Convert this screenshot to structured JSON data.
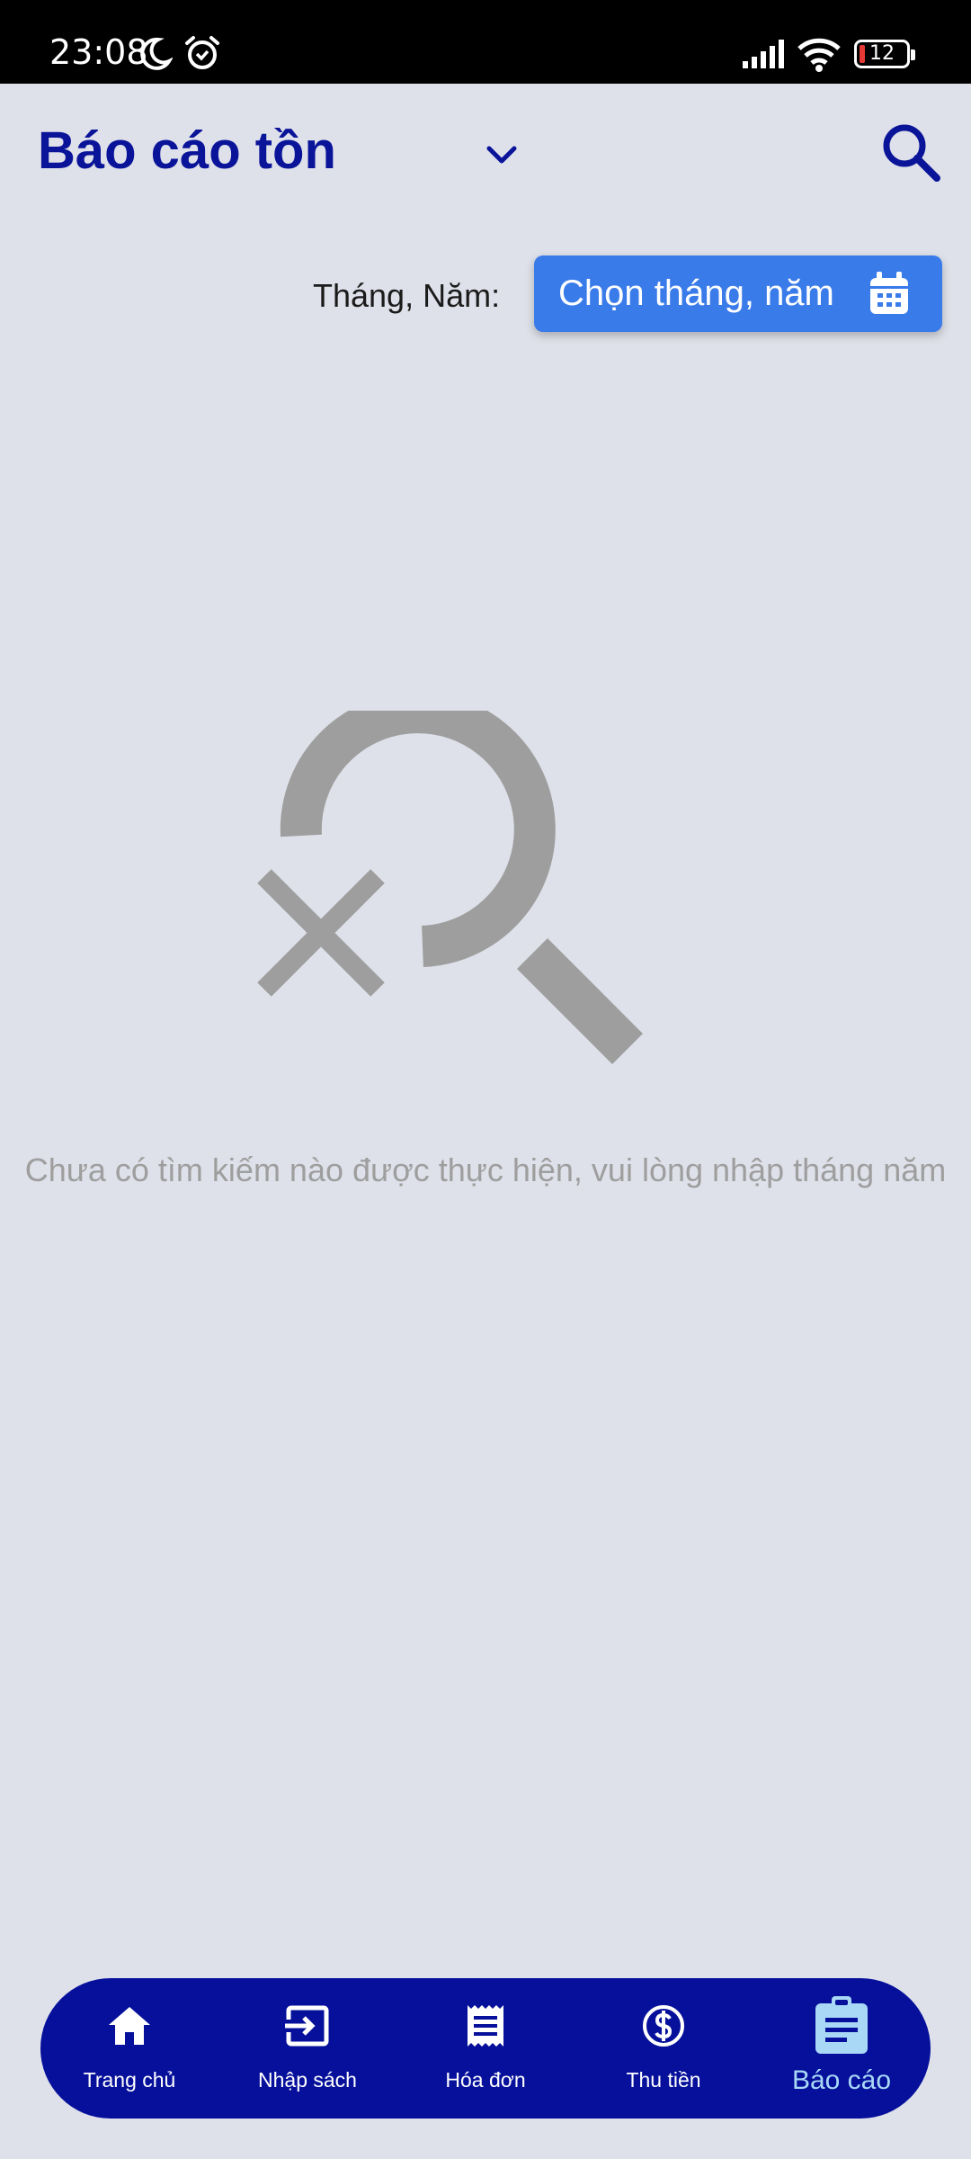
{
  "status_bar": {
    "time": "23:08",
    "icons": [
      "moon-icon",
      "alarm-icon",
      "signal-icon",
      "wifi-icon",
      "battery-icon"
    ],
    "battery_level": "12"
  },
  "header": {
    "title": "Báo cáo tồn",
    "dropdown_icon": "chevron-down-icon",
    "search_icon": "search-icon"
  },
  "filter": {
    "label": "Tháng, Năm:",
    "button_label": "Chọn tháng, năm",
    "button_icon": "calendar-icon"
  },
  "empty_state": {
    "icon": "search-off-icon",
    "message": "Chưa có tìm kiếm nào được thực hiện, vui lòng nhập tháng năm"
  },
  "bottom_nav": {
    "items": [
      {
        "label": "Trang chủ",
        "icon": "home-icon"
      },
      {
        "label": "Nhập sách",
        "icon": "input-icon"
      },
      {
        "label": "Hóa đơn",
        "icon": "receipt-icon"
      },
      {
        "label": "Thu tiền",
        "icon": "dollar-icon"
      },
      {
        "label": "Báo cáo",
        "icon": "clipboard-icon",
        "active": true
      }
    ]
  },
  "colors": {
    "background": "#dfe1ea",
    "primary": "#0a1499",
    "accent_button": "#3a7bea",
    "nav_background": "#06109a",
    "active_nav": "#a9d8f7",
    "muted": "#9e9e9e"
  }
}
